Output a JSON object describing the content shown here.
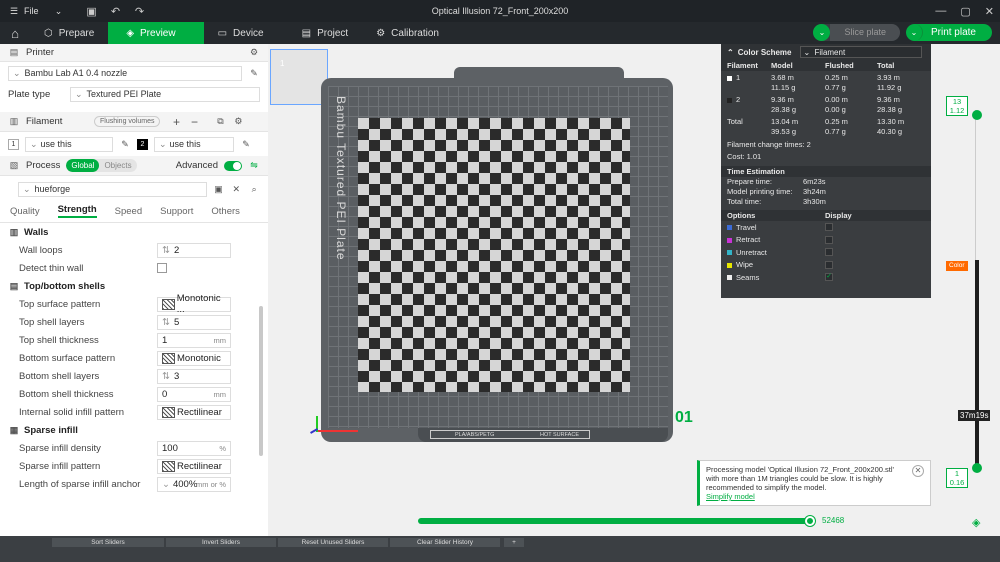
{
  "window": {
    "title": "Optical Illusion 72_Front_200x200",
    "file_menu": "File"
  },
  "toolbar": {
    "tabs": [
      "Prepare",
      "Preview",
      "Device",
      "Project",
      "Calibration"
    ],
    "active_tab": "Preview",
    "slice_label": "Slice plate",
    "print_label": "Print plate"
  },
  "printer": {
    "section_label": "Printer",
    "name": "Bambu Lab A1 0.4 nozzle",
    "plate_type_label": "Plate type",
    "plate_type": "Textured PEI Plate"
  },
  "filament": {
    "section_label": "Filament",
    "flushing_label": "Flushing volumes",
    "slots": [
      {
        "num": "1",
        "value": "use this"
      },
      {
        "num": "2",
        "value": "use this"
      }
    ]
  },
  "process": {
    "section_label": "Process",
    "global_label": "Global",
    "objects_label": "Objects",
    "advanced_label": "Advanced",
    "search_value": "hueforge",
    "subtabs": [
      "Quality",
      "Strength",
      "Speed",
      "Support",
      "Others"
    ],
    "active_subtab": "Strength"
  },
  "settings": {
    "walls_title": "Walls",
    "wall_loops_label": "Wall loops",
    "wall_loops": "2",
    "detect_thin_label": "Detect thin wall",
    "shells_title": "Top/bottom shells",
    "top_pattern_label": "Top surface pattern",
    "top_pattern": "Monotonic ...",
    "top_layers_label": "Top shell layers",
    "top_layers": "5",
    "top_thickness_label": "Top shell thickness",
    "top_thickness": "1",
    "bottom_pattern_label": "Bottom surface pattern",
    "bottom_pattern": "Monotonic",
    "bottom_layers_label": "Bottom shell layers",
    "bottom_layers": "3",
    "bottom_thickness_label": "Bottom shell thickness",
    "bottom_thickness": "0",
    "internal_infill_label": "Internal solid infill pattern",
    "internal_infill": "Rectilinear",
    "sparse_title": "Sparse infill",
    "sparse_density_label": "Sparse infill density",
    "sparse_density": "100",
    "sparse_pattern_label": "Sparse infill pattern",
    "sparse_pattern": "Rectilinear",
    "anchor_label": "Length of sparse infill anchor",
    "anchor": "400%",
    "anchor_unit": "mm or %",
    "units": {
      "mm": "mm",
      "pct": "%"
    }
  },
  "bottom_buttons": [
    "Sort Sliders",
    "Invert Sliders",
    "Reset Unused Sliders",
    "Clear Slider History",
    "+"
  ],
  "viewport": {
    "plate_label": "Bambu Textured PEI Plate",
    "plate_id": "01",
    "plate_thumb_num": "1",
    "plate_tag": "PLA/ABS/PETG",
    "plate_tag2": "HOT SURFACE"
  },
  "legend": {
    "color_scheme_label": "Color Scheme",
    "scheme": "Filament",
    "headers": [
      "Filament",
      "Model",
      "Flushed",
      "Total"
    ],
    "rows": [
      {
        "name": "1",
        "swatch": "#ffffff",
        "model": "3.68 m",
        "model2": "11.15 g",
        "flushed": "0.25 m",
        "flushed2": "0.77 g",
        "total": "3.93 m",
        "total2": "11.92 g"
      },
      {
        "name": "2",
        "swatch": "#222222",
        "model": "9.36 m",
        "model2": "28.38 g",
        "flushed": "0.00 m",
        "flushed2": "0.00 g",
        "total": "9.36 m",
        "total2": "28.38 g"
      },
      {
        "name": "Total",
        "swatch": "",
        "model": "13.04 m",
        "model2": "39.53 g",
        "flushed": "0.25 m",
        "flushed2": "0.77 g",
        "total": "13.30 m",
        "total2": "40.30 g"
      }
    ],
    "change_times_label": "Filament change times:",
    "change_times": "2",
    "cost_label": "Cost:",
    "cost": "1.01",
    "time_title": "Time Estimation",
    "prepare_label": "Prepare time:",
    "prepare": "6m23s",
    "printing_label": "Model printing time:",
    "printing": "3h24m",
    "total_label": "Total time:",
    "total": "3h30m",
    "options_label": "Options",
    "display_label": "Display",
    "options": [
      {
        "name": "Travel",
        "color": "#3b6bd6",
        "checked": false
      },
      {
        "name": "Retract",
        "color": "#c832d6",
        "checked": false
      },
      {
        "name": "Unretract",
        "color": "#32b4c8",
        "checked": false
      },
      {
        "name": "Wipe",
        "color": "#e6e600",
        "checked": false
      },
      {
        "name": "Seams",
        "color": "#eeeeee",
        "checked": true
      }
    ]
  },
  "vslider": {
    "top_value": "13",
    "top_height": "1.12",
    "bottom_value": "1",
    "bottom_height": "0.16",
    "color_label": "Color",
    "time": "37m19s"
  },
  "hslider": {
    "value": "52468"
  },
  "notification": {
    "text": "Processing model 'Optical Illusion 72_Front_200x200.stl' with more than 1M triangles could be slow. It is highly recommended to simplify the model.",
    "link": "Simplify model"
  }
}
